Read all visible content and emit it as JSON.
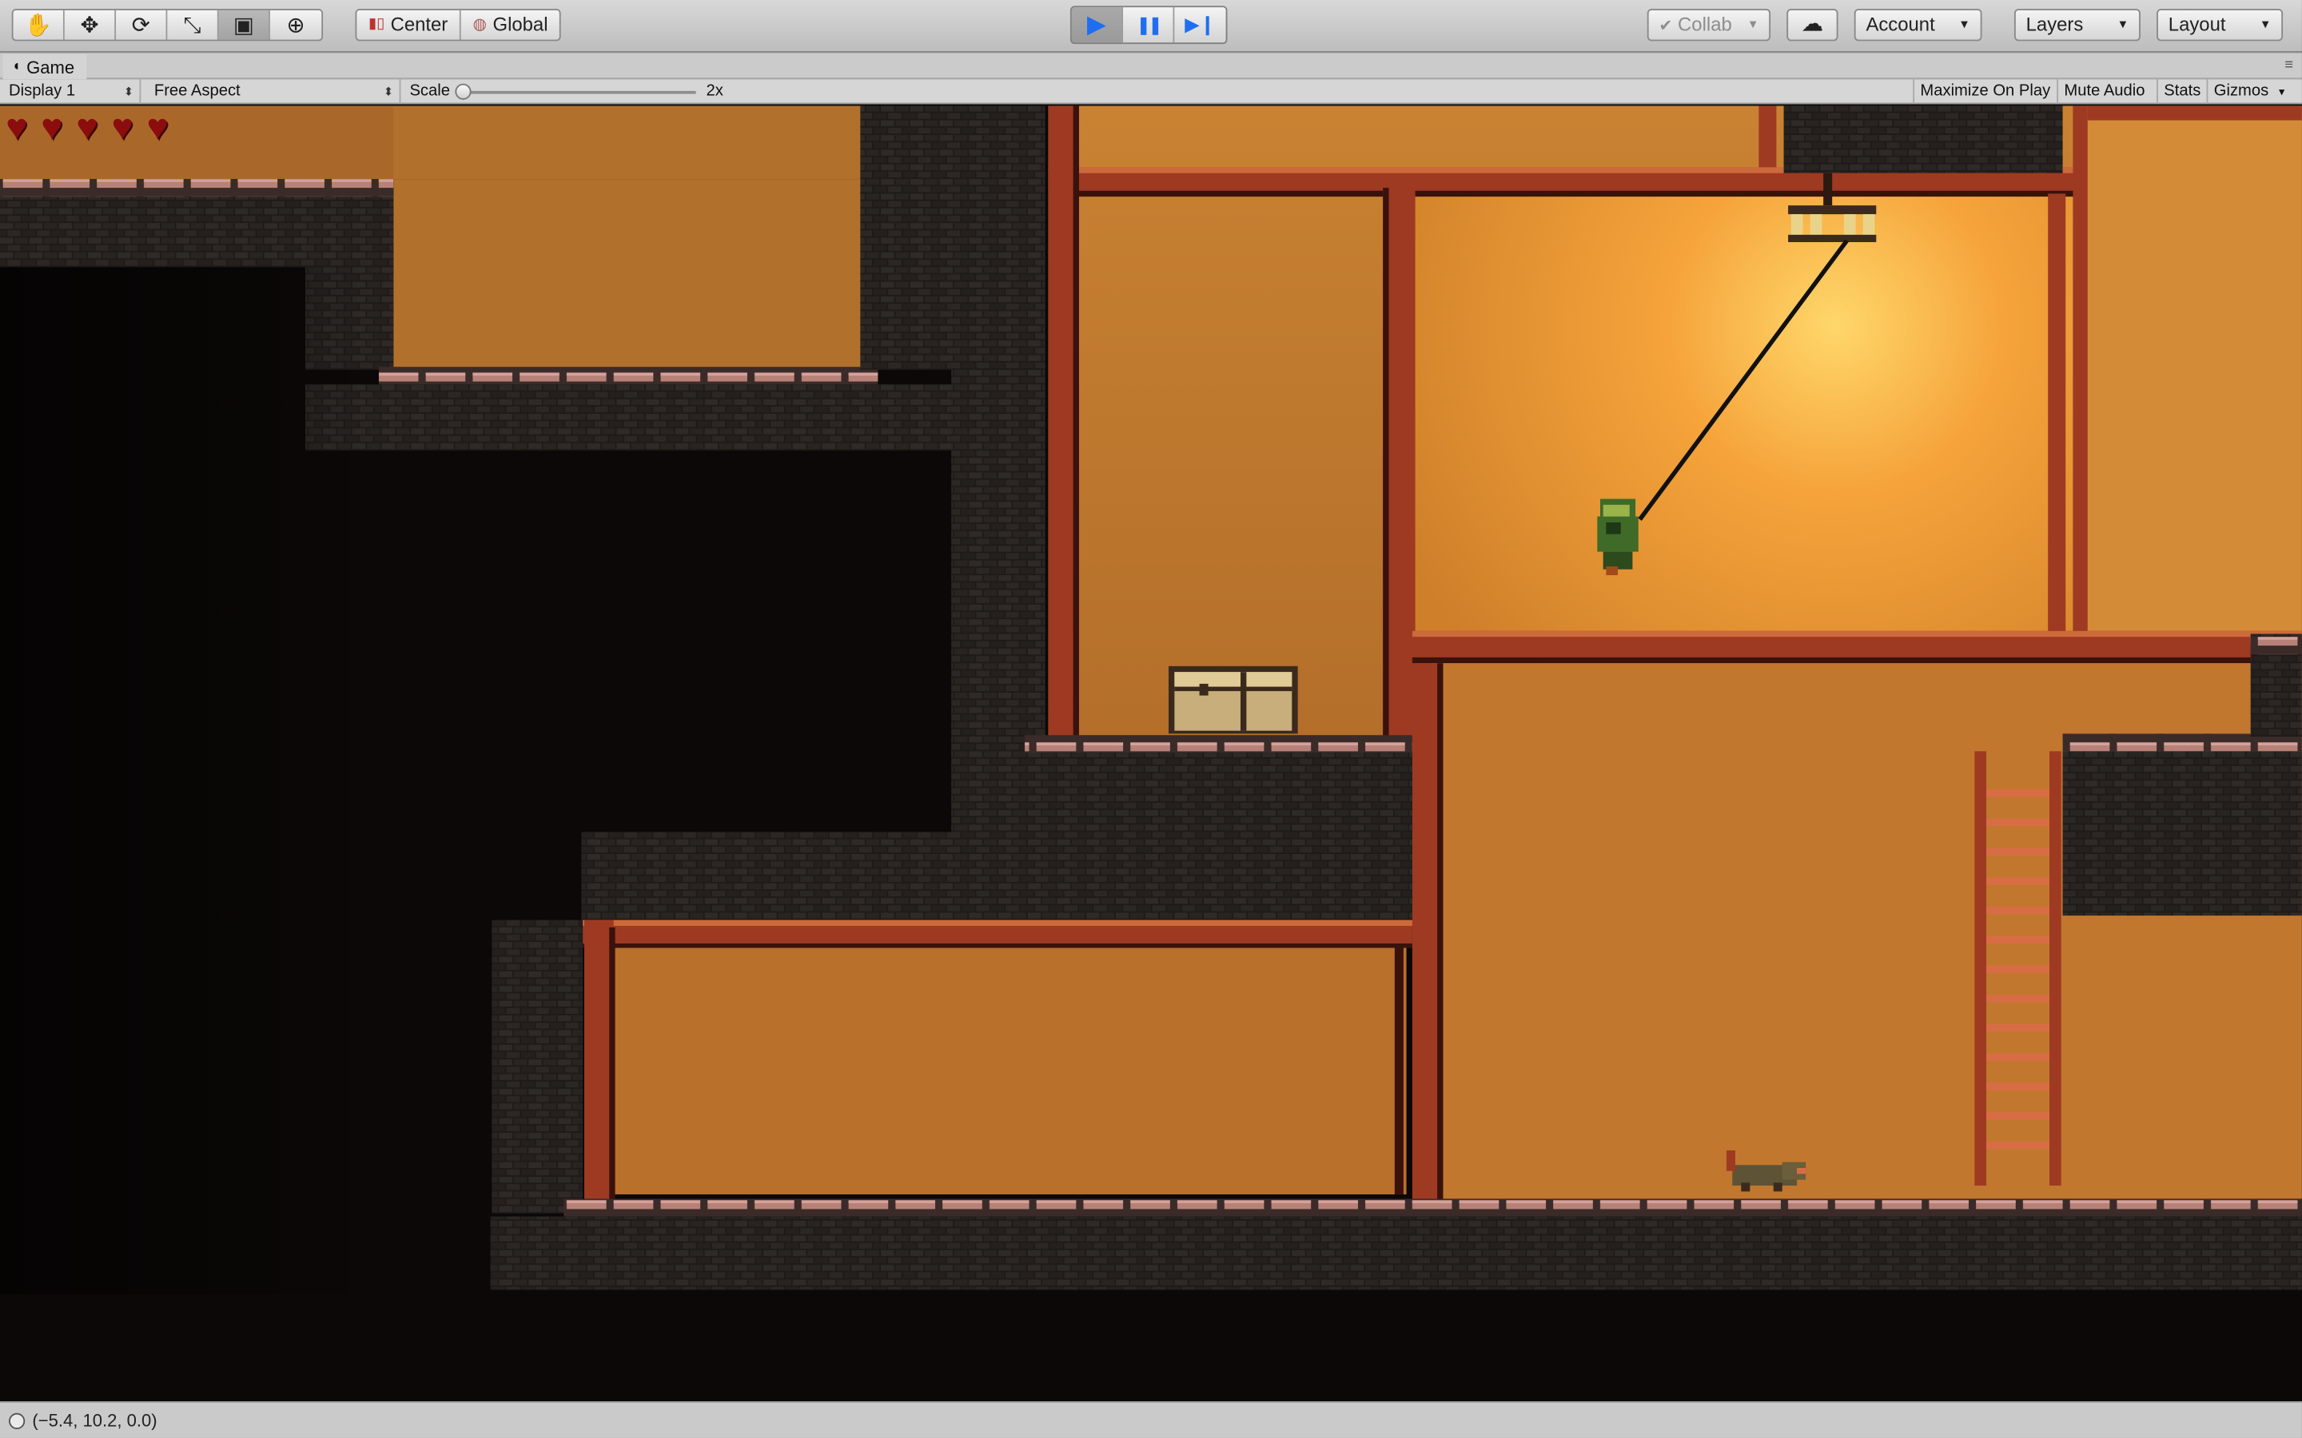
{
  "toolbar": {
    "tools": [
      {
        "name": "hand-tool-icon",
        "glyph": "✋"
      },
      {
        "name": "move-tool-icon",
        "glyph": "✥"
      },
      {
        "name": "rotate-tool-icon",
        "glyph": "⟳"
      },
      {
        "name": "scale-tool-icon",
        "glyph": "⤡"
      },
      {
        "name": "rect-tool-icon",
        "glyph": "▣"
      },
      {
        "name": "transform-tool-icon",
        "glyph": "⊕"
      }
    ],
    "pivot_label": "Center",
    "space_label": "Global",
    "play_glyph": "▶",
    "pause_glyph": "❚❚",
    "step_glyph": "▶❙",
    "collab_label": "Collab",
    "cloud_glyph": "☁",
    "account_label": "Account",
    "layers_label": "Layers",
    "layout_label": "Layout"
  },
  "tab": {
    "title": "Game"
  },
  "gamebar": {
    "display": "Display 1",
    "aspect": "Free Aspect",
    "scale_label": "Scale",
    "scale_value": "2x",
    "maximize_on_play": "Maximize On Play",
    "mute_audio": "Mute Audio",
    "stats": "Stats",
    "gizmos": "Gizmos"
  },
  "game": {
    "hearts": 5,
    "heart_color": "#8c0d0d",
    "background_glow": "#f2a23a"
  },
  "status": {
    "text": "(−5.4, 10.2, 0.0)"
  },
  "colors": {
    "accent": "#1f6ef2",
    "toolbar_bg": "#c8c8c8",
    "beam": "#9e3a22",
    "brick": "#2a2522"
  }
}
